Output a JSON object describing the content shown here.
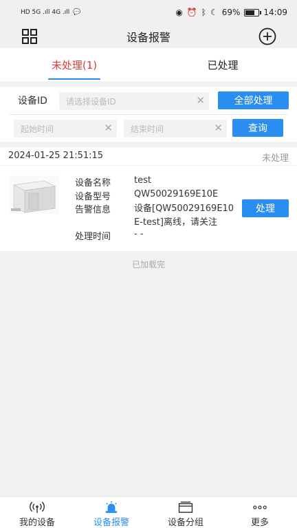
{
  "status_bar": {
    "left_text": "HD 5G .ıll 4G .ıll",
    "battery": "69%",
    "time": "14:09"
  },
  "nav": {
    "title": "设备报警"
  },
  "tabs": [
    {
      "label": "未处理(1)",
      "active": true
    },
    {
      "label": "已处理",
      "active": false
    }
  ],
  "filter": {
    "device_id_label": "设备ID",
    "device_id_placeholder": "请选择设备ID",
    "process_all_label": "全部处理",
    "start_time_placeholder": "起始时间",
    "end_time_placeholder": "结束时间",
    "query_label": "查询"
  },
  "records": [
    {
      "timestamp": "2024-01-25 21:51:15",
      "status": "未处理",
      "fields": [
        {
          "key": "设备名称",
          "value": "test"
        },
        {
          "key": "设备型号",
          "value": "QW50029169E10E"
        },
        {
          "key": "告警信息",
          "value": "设备[QW50029169E10E-test]离线，请关注"
        },
        {
          "key": "处理时间",
          "value": "- -"
        }
      ],
      "action_label": "处理"
    }
  ],
  "list_footer": "已加载完",
  "bottom_nav": [
    {
      "label": "我的设备",
      "icon": "signal-icon",
      "active": false
    },
    {
      "label": "设备报警",
      "icon": "alarm-light-icon",
      "active": true
    },
    {
      "label": "设备分组",
      "icon": "folder-icon",
      "active": false
    },
    {
      "label": "更多",
      "icon": "more-icon",
      "active": false
    }
  ],
  "colors": {
    "accent_blue": "#2a8df0",
    "active_tab_red": "#e53935"
  }
}
